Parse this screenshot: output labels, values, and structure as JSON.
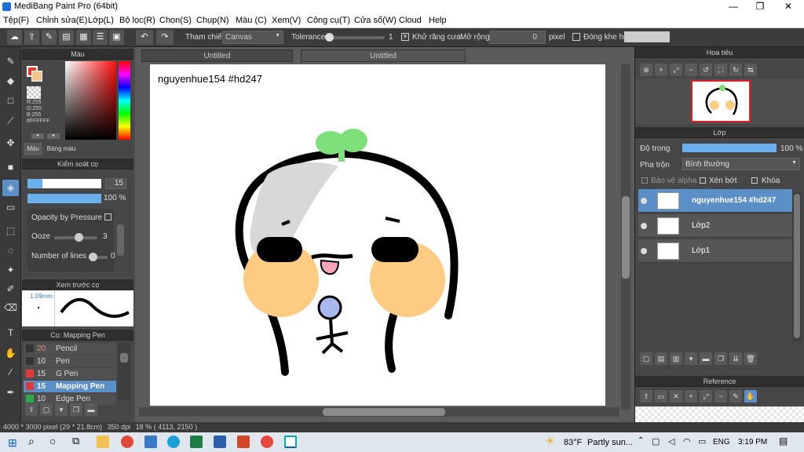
{
  "window": {
    "title": "MediBang Paint Pro (64bit)",
    "minimize": "—",
    "maximize": "❐",
    "close": "✕"
  },
  "menu": [
    "Tệp(F)",
    "Chỉnh sửa(E)",
    "Lớp(L)",
    "Bộ lọc(R)",
    "Chọn(S)",
    "Chụp(N)",
    "Màu (C)",
    "Xem(V)",
    "Công cụ(T)",
    "Cửa sổ(W)",
    "Cloud",
    "Help"
  ],
  "toolbar": {
    "reference_label": "Tham chiếu",
    "reference_value": "Canvas",
    "tolerance_label": "Tolerance",
    "tolerance_value": "1",
    "antialias_label": "Khử răng cưa",
    "expand_label": "Mở rộng",
    "expand_value": "0",
    "expand_unit": "pixel",
    "gap_label": "Đóng khe hở"
  },
  "color_panel": {
    "title": "Màu",
    "rgb_r": "R:255",
    "rgb_g": "G:255",
    "rgb_b": "B:255",
    "hex": "#FFFFFF",
    "tab_color": "Màu",
    "tab_palette": "Bảng màu",
    "main_color": "#e53935",
    "sub_color": "#ffffff"
  },
  "brush_control": {
    "title": "Kiểm soát cọ",
    "size": "15",
    "opacity": "100 %",
    "size_fraction": 0.2,
    "opacity_fraction": 1.0,
    "opacity_by_pressure": "Opacity by Pressure",
    "ooze_label": "Ooze",
    "ooze_value": "3",
    "ooze_fraction": 0.6,
    "lines_label": "Number of lines",
    "lines_value": "0",
    "lines_fraction": 0.0
  },
  "brush_preview": {
    "title": "Xem trước cọ",
    "size": "1.09mm"
  },
  "brush_list": {
    "title": "Cọ: Mapping Pen",
    "items": [
      {
        "size": "20",
        "name": "Pencil",
        "color": "#333333",
        "selected": false
      },
      {
        "size": "10",
        "name": "Pen",
        "color": "#333333",
        "selected": false
      },
      {
        "size": "15",
        "name": "G Pen",
        "color": "#e53935",
        "selected": false
      },
      {
        "size": "15",
        "name": "Mapping Pen",
        "color": "#e53935",
        "selected": true
      },
      {
        "size": "10",
        "name": "Edge Pen",
        "color": "#2ea84a",
        "selected": false
      }
    ]
  },
  "tabs": [
    "Untitled",
    "Untitled"
  ],
  "canvas": {
    "caption": "nguyenhue154 #hd247"
  },
  "navigator": {
    "title": "Hoa tiêu"
  },
  "layer_panel": {
    "title": "Lớp",
    "opacity_label": "Độ trong",
    "opacity_value": "100 %",
    "opacity_fraction": 1.0,
    "blend_label": "Pha trộn",
    "blend_value": "Bình thường",
    "protect_alpha": "Bảo vệ alpha",
    "clipping": "Xén bớt",
    "lock": "Khóa",
    "layers": [
      {
        "name": "nguyenhue154 #hd247",
        "selected": true
      },
      {
        "name": "Lớp2",
        "selected": false
      },
      {
        "name": "Lớp1",
        "selected": false
      }
    ]
  },
  "reference": {
    "title": "Reference"
  },
  "status": {
    "size": "4000 * 3000 pixel",
    "dimensions": "(29 * 21.8cm)",
    "dpi": "350 dpi",
    "zoom": "18 %",
    "coords": "( 4113, 2150 )"
  },
  "taskbar": {
    "temperature": "83°F",
    "weather": "Partly sun...",
    "language": "ENG",
    "time": "3:19 PM"
  },
  "colors": {
    "accent": "#5a8fc8",
    "panel": "#474747",
    "dark": "#3a3a3a"
  }
}
